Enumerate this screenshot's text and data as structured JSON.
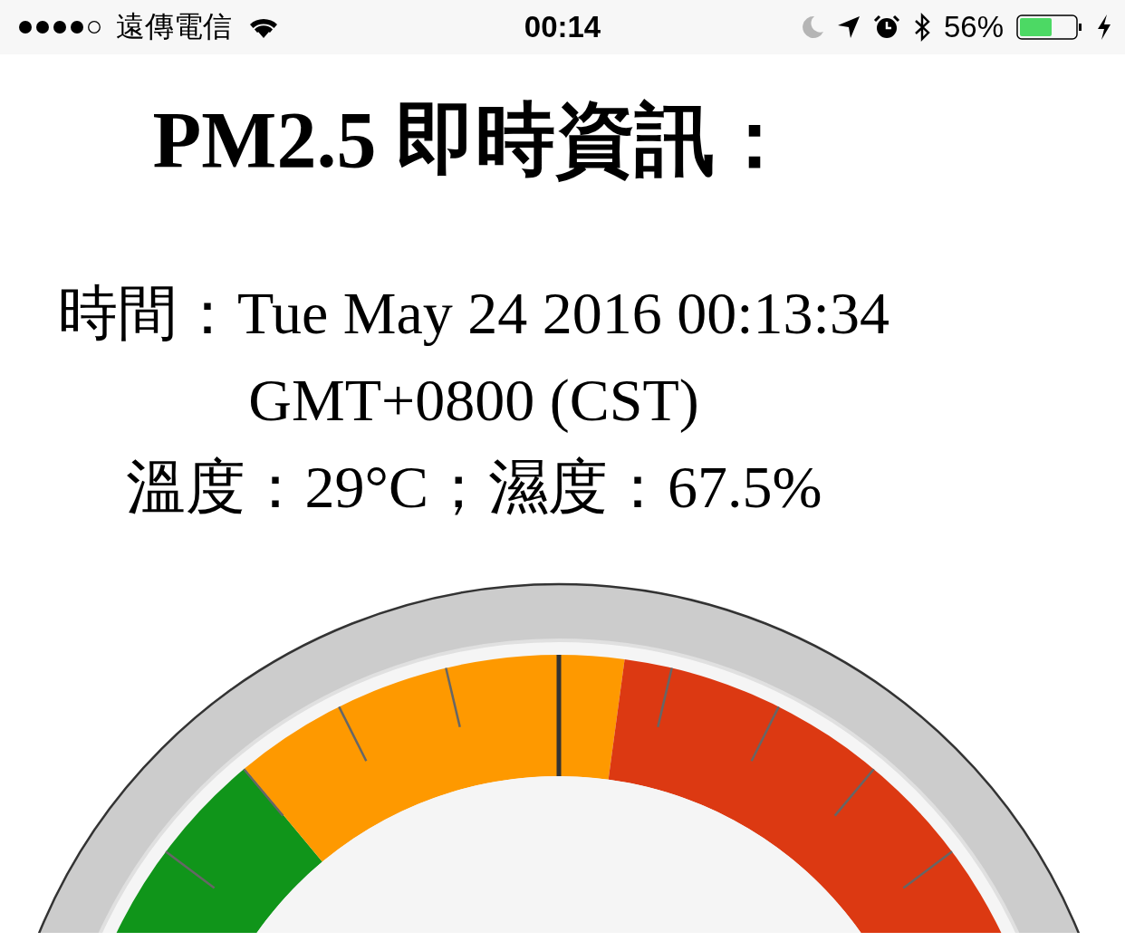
{
  "status_bar": {
    "carrier": "遠傳電信",
    "time": "00:14",
    "battery_text": "56%"
  },
  "title": "PM2.5 即時資訊：",
  "time_line": "時間：Tue May 24 2016 00:13:34 GMT+0800 (CST)",
  "weather_line": "溫度：29°C；濕度：67.5%"
}
